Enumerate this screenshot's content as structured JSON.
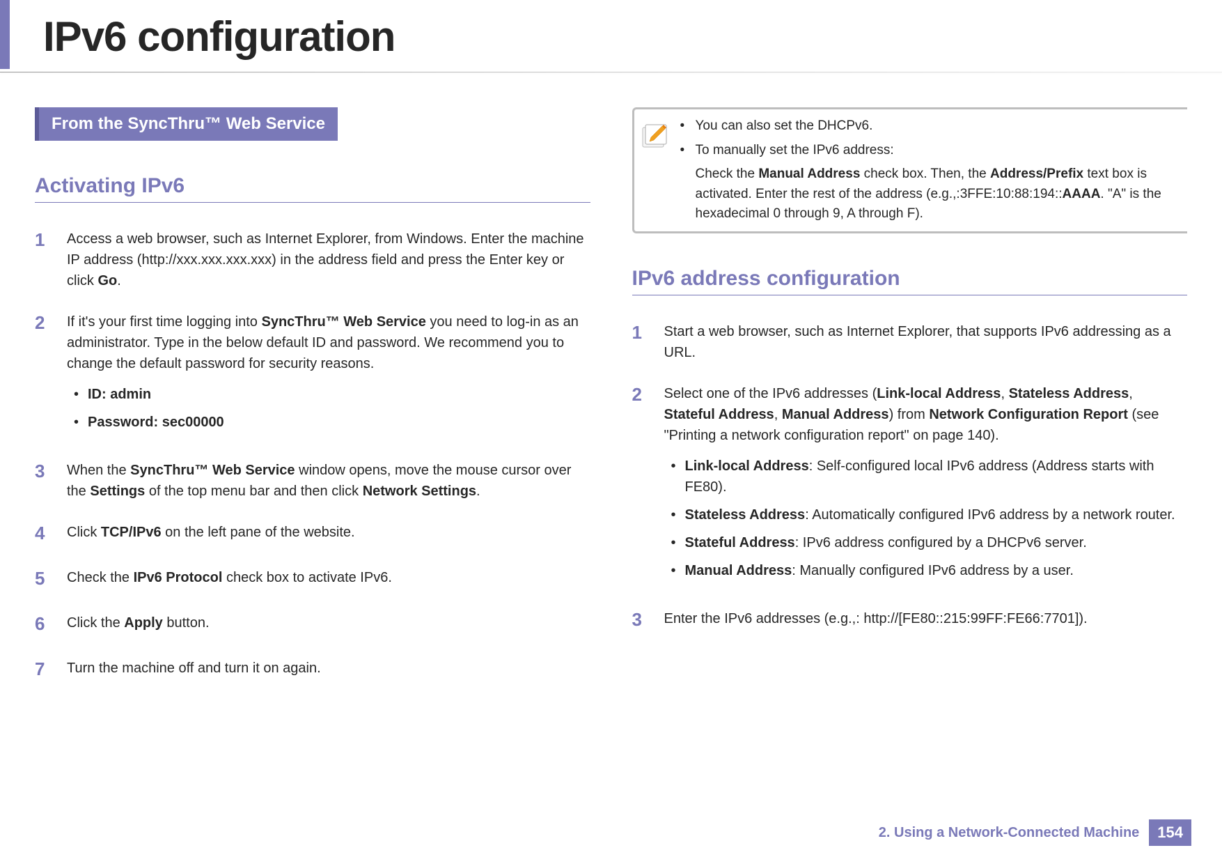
{
  "title": "IPv6 configuration",
  "left": {
    "banner": "From the SyncThru™ Web Service",
    "subsection": "Activating IPv6",
    "steps": {
      "s1": {
        "num": "1",
        "text_before": "Access a web browser, such as Internet Explorer, from Windows.  Enter the machine IP address (http://xxx.xxx.xxx.xxx) in the address field and press the Enter key or click ",
        "bold1": "Go",
        "text_after": "."
      },
      "s2": {
        "num": "2",
        "text_before": "If it's your first time logging into ",
        "bold1": "SyncThru™ Web Service",
        "text_after": " you need to log-in as an administrator. Type in the below default ID and password. We recommend you to change the default password for security reasons.",
        "bullets": {
          "b1": "ID: admin",
          "b2": "Password: sec00000"
        }
      },
      "s3": {
        "num": "3",
        "t1": "When the ",
        "b1": "SyncThru™ Web Service",
        "t2": " window opens, move the mouse cursor over the ",
        "b2": "Settings",
        "t3": " of the top menu bar and then click ",
        "b3": "Network Settings",
        "t4": "."
      },
      "s4": {
        "num": "4",
        "t1": "Click ",
        "b1": "TCP/IPv6",
        "t2": " on the left pane of the website."
      },
      "s5": {
        "num": "5",
        "t1": "Check the ",
        "b1": "IPv6 Protocol",
        "t2": " check box to activate IPv6."
      },
      "s6": {
        "num": "6",
        "t1": "Click the ",
        "b1": "Apply",
        "t2": " button."
      },
      "s7": {
        "num": "7",
        "t1": "Turn the machine off and turn it on again."
      }
    }
  },
  "right": {
    "note": {
      "line1": "You can also set the DHCPv6.",
      "line2": "To manually set the IPv6 address:",
      "sub_t1": "Check the ",
      "sub_b1": "Manual Address",
      "sub_t2": " check box. Then, the ",
      "sub_b2": "Address/Prefix",
      "sub_t3": " text box is activated. Enter the rest of the address (e.g.,:3FFE:10:88:194::",
      "sub_b3": "AAAA",
      "sub_t4": ". \"A\" is the hexadecimal 0 through 9, A through F)."
    },
    "subsection": "IPv6 address configuration",
    "steps": {
      "s1": {
        "num": "1",
        "t1": "Start a web browser, such as Internet Explorer, that supports IPv6 addressing as a URL."
      },
      "s2": {
        "num": "2",
        "t1": "Select one of the IPv6 addresses (",
        "b1": "Link-local Address",
        "t2": ", ",
        "b2": "Stateless Address",
        "t3": ", ",
        "b3": "Stateful Address",
        "t4": ", ",
        "b4": "Manual Address",
        "t5": ") from ",
        "b5": "Network Configuration Report",
        "t6": " (see \"Printing a network configuration report\" on page 140).",
        "bullets": {
          "bl1": {
            "label": "Link-local Address",
            "desc": ": Self-configured local IPv6 address (Address starts with FE80)."
          },
          "bl2": {
            "label": "Stateless Address",
            "desc": ": Automatically configured IPv6 address by a network router."
          },
          "bl3": {
            "label": "Stateful Address",
            "desc": ": IPv6 address configured by a DHCPv6 server."
          },
          "bl4": {
            "label": "Manual Address",
            "desc": ": Manually configured IPv6 address by a user."
          }
        }
      },
      "s3": {
        "num": "3",
        "t1": "Enter the IPv6 addresses (e.g.,: http://[FE80::215:99FF:FE66:7701])."
      }
    }
  },
  "footer": {
    "text": "2.  Using a Network-Connected Machine",
    "page": "154"
  }
}
